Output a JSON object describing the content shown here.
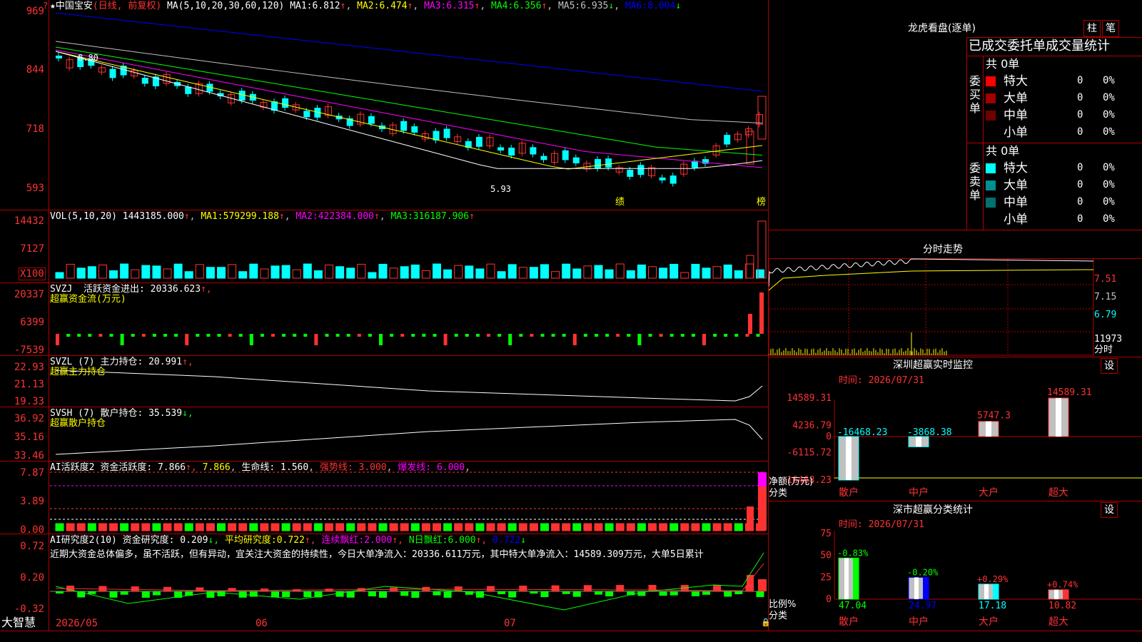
{
  "colors": {
    "up": "#ff3232",
    "down": "#00ffff",
    "grid": "#b00000",
    "ma1": "#ffffff",
    "ma2": "#ffff00",
    "ma3": "#ff00ff",
    "ma4": "#00ff00",
    "ma5": "#c0c0c0",
    "ma6": "#0000ff"
  },
  "kline": {
    "stock_name": "中国宝安",
    "period": "(日线, 前复权)",
    "ma_params": "MA(5,10,20,30,60,120)",
    "ma": [
      {
        "label": "MA1:",
        "value": "6.812",
        "arrow": "↑"
      },
      {
        "label": "MA2:",
        "value": "6.474",
        "arrow": "↑"
      },
      {
        "label": "MA3:",
        "value": "6.315",
        "arrow": "↑"
      },
      {
        "label": "MA4:",
        "value": "6.356",
        "arrow": "↑"
      },
      {
        "label": "MA5:",
        "value": "6.935",
        "arrow": "↓"
      },
      {
        "label": "MA6:",
        "value": "8.004",
        "arrow": "↓"
      }
    ],
    "y_ticks": [
      "969",
      "844",
      "718",
      "593"
    ],
    "high_note": "8.80",
    "low_note": "5.93",
    "marker_ji": "绩",
    "marker_bang": "榜"
  },
  "vol": {
    "params": "VOL(5,10,20)",
    "value": "1443185.000",
    "arrow": "↑",
    "ma": [
      {
        "label": "MA1:",
        "value": "579299.188",
        "arrow": "↑"
      },
      {
        "label": "MA2:",
        "value": "422384.000",
        "arrow": "↑"
      },
      {
        "label": "MA3:",
        "value": "316187.906",
        "arrow": "↑"
      }
    ],
    "y_ticks": [
      "14432",
      "7127"
    ],
    "unit": "X100"
  },
  "svzj": {
    "name": "SVZJ",
    "label": "活跃资金进出:",
    "value": "20336.623",
    "arrow": "↑,",
    "sub": "超赢资金流(万元)",
    "y_ticks": [
      "20337",
      "6399",
      "-7539"
    ]
  },
  "svzl": {
    "name": "SVZL",
    "param": "(7)",
    "label": "主力持仓:",
    "value": "20.991",
    "arrow": "↑,",
    "sub": "超赢主力持仓",
    "y_ticks": [
      "22.93",
      "21.13",
      "19.33"
    ]
  },
  "svsh": {
    "name": "SVSH",
    "param": "(7)",
    "label": "散户持仓:",
    "value": "35.539",
    "arrow": "↓,",
    "sub": "超赢散户持仓",
    "y_ticks": [
      "36.92",
      "35.16",
      "33.46"
    ]
  },
  "ai_active": {
    "name": "AI活跃度2",
    "label": "资金活跃度:",
    "value": "7.866",
    "arrow": "↑,",
    "value2": "7.866",
    "label2": "生命线:",
    "value3": "1.560",
    "label3": "强势线:",
    "value4": "3.000",
    "label4": "爆发线:",
    "value5": "6.000",
    "y_ticks": [
      "7.87",
      "3.89",
      "0.00"
    ]
  },
  "ai_research": {
    "name": "AI研究度2(10)",
    "label": "资金研究度:",
    "value": "0.209",
    "arrow": "↓,",
    "label2": "平均研究度:",
    "value2": "0.722",
    "arrow2": "↑,",
    "label3": "连续飘红:",
    "value3": "2.000",
    "arrow3": "↑,",
    "label4": "N日飘红:",
    "value4": "6.000",
    "arrow4": "↑,",
    "value5": "0.722",
    "arrow5": "↓",
    "comment": "近期大资金总体偏多，虽不活跃，但有异动，宜关注大资金的持续性，今日大单净流入：20336.611万元，其中特大单净流入：14589.309万元，大单5日累计",
    "y_ticks": [
      "0.72",
      "0.20",
      "-0.32"
    ]
  },
  "footer": {
    "brand": "大智慧",
    "dates": [
      "2026/05",
      "06",
      "07"
    ]
  },
  "panel_lhb": {
    "title": "龙虎看盘(逐单)",
    "btn1": "柱",
    "btn2": "笔",
    "header": "已成交委托单成交量统计",
    "buy": {
      "side": "委买单",
      "total": "共 0单",
      "rows": [
        {
          "name": "特大",
          "count": "0",
          "pct": "0%",
          "color": "#ff0000"
        },
        {
          "name": "大单",
          "count": "0",
          "pct": "0%",
          "color": "#a00000"
        },
        {
          "name": "中单",
          "count": "0",
          "pct": "0%",
          "color": "#700000"
        },
        {
          "name": "小单",
          "count": "0",
          "pct": "0%",
          "color": ""
        }
      ]
    },
    "sell": {
      "side": "委卖单",
      "total": "共 0单",
      "rows": [
        {
          "name": "特大",
          "count": "0",
          "pct": "0%",
          "color": "#00ffff"
        },
        {
          "name": "大单",
          "count": "0",
          "pct": "0%",
          "color": "#009090"
        },
        {
          "name": "中单",
          "count": "0",
          "pct": "0%",
          "color": "#007070"
        },
        {
          "name": "小单",
          "count": "0",
          "pct": "0%",
          "color": ""
        }
      ]
    }
  },
  "panel_fenshi": {
    "title": "分时走势",
    "y_ticks": [
      "7.51",
      "7.15",
      "6.79",
      "11973"
    ],
    "unit": "分时"
  },
  "panel_monitor": {
    "title": "深圳超赢实时监控",
    "btn": "设",
    "time": "时间: 2026/07/31",
    "y_ticks": [
      "14589.31",
      "4236.79",
      "0",
      "-6115.72",
      "-16468.23"
    ],
    "bars": [
      {
        "cat": "散户",
        "value": -16468.23,
        "label": "-16468.23"
      },
      {
        "cat": "中户",
        "value": -3868.38,
        "label": "-3868.38"
      },
      {
        "cat": "大户",
        "value": 5747.3,
        "label": "5747.3"
      },
      {
        "cat": "超大",
        "value": 14589.31,
        "label": "14589.31"
      }
    ],
    "legend1": "净额(万元)",
    "legend2": "分类"
  },
  "panel_class": {
    "title": "深市超赢分类统计",
    "btn": "设",
    "time": "时间: 2026/07/31",
    "y_ticks": [
      "75",
      "50",
      "25",
      "0"
    ],
    "bars": [
      {
        "cat": "散户",
        "value": 47.04,
        "label": "47.04",
        "chg": "-0.83%"
      },
      {
        "cat": "中户",
        "value": 24.97,
        "label": "24.97",
        "chg": "-0.20%"
      },
      {
        "cat": "大户",
        "value": 17.18,
        "label": "17.18",
        "chg": "+0.29%"
      },
      {
        "cat": "超大",
        "value": 10.82,
        "label": "10.82",
        "chg": "+0.74%"
      }
    ],
    "legend1": "比例%",
    "legend2": "分类"
  }
}
